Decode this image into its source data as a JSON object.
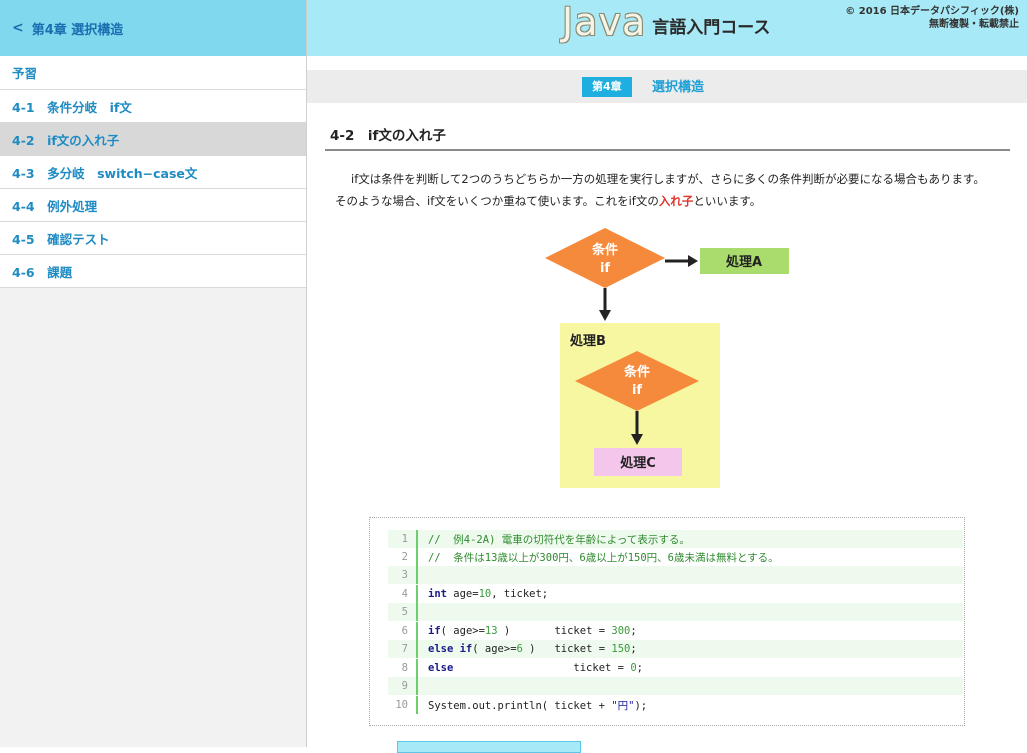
{
  "sidebar": {
    "back_label": "第4章 選択構造",
    "items": [
      {
        "label": "予習"
      },
      {
        "label": "4-1　条件分岐　if文"
      },
      {
        "label": "4-2　if文の入れ子"
      },
      {
        "label": "4-3　多分岐　switch−case文"
      },
      {
        "label": "4-4　例外処理"
      },
      {
        "label": "4-5　確認テスト"
      },
      {
        "label": "4-6　課題"
      }
    ],
    "active_index": 2
  },
  "header": {
    "logo_java": "Java",
    "logo_course": "言語入門コース",
    "copyright_line1": "© 2016 日本データパシフィック(株)",
    "copyright_line2": "無断複製・転載禁止"
  },
  "chapter": {
    "badge": "第4章",
    "title": "選択構造"
  },
  "section": {
    "title": "4-2　if文の入れ子",
    "para_part1": "if文は条件を判断して2つのうちどちらか一方の処理を実行しますが、さらに多くの条件判断が必要になる場合もあります。　そのような場合、if文をいくつか重ねて使います。これをif文の",
    "para_highlight": "入れ子",
    "para_part2": "といいます。"
  },
  "flowchart": {
    "cond1_line1": "条件",
    "cond1_line2": "if",
    "process_a": "処理A",
    "process_b": "処理B",
    "cond2_line1": "条件",
    "cond2_line2": "if",
    "process_c": "処理C"
  },
  "code": {
    "lines": [
      {
        "n": "1",
        "text": "//  例4-2A) 電車の切符代を年齢によって表示する。"
      },
      {
        "n": "2",
        "text": "//  条件は13歳以上が300円、6歳以上が150円、6歳未満は無料とする。"
      },
      {
        "n": "3",
        "text": ""
      },
      {
        "n": "4",
        "text": "int age=10, ticket;"
      },
      {
        "n": "5",
        "text": ""
      },
      {
        "n": "6",
        "text": "if( age>=13 )       ticket = 300;"
      },
      {
        "n": "7",
        "text": "else if( age>=6 )   ticket = 150;"
      },
      {
        "n": "8",
        "text": "else                   ticket = 0;"
      },
      {
        "n": "9",
        "text": ""
      },
      {
        "n": "10",
        "text": "System.out.println( ticket + \"円\");"
      }
    ]
  },
  "colors": {
    "accent": "#1eaee0",
    "header_bg": "#a7e9f6",
    "diamond": "#f58a3c",
    "process_a": "#a9dc6c",
    "process_b": "#f6f7a0",
    "process_c": "#f4c6ec"
  }
}
